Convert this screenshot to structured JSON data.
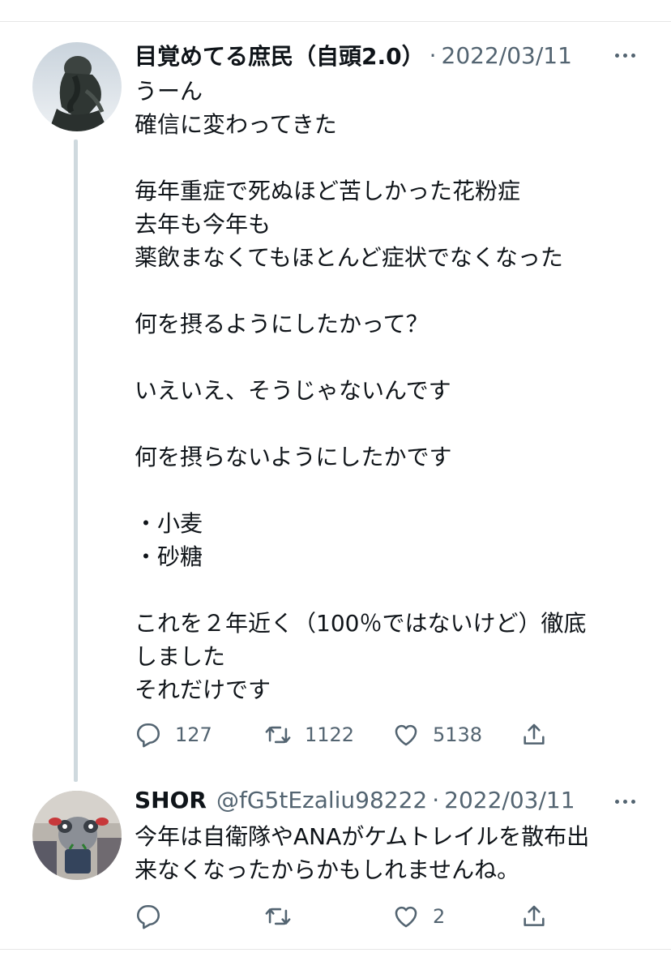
{
  "tweets": [
    {
      "name": "目覚めてる庶民（自頭2.0）",
      "handle": "",
      "date": "2022/03/11",
      "text": "うーん\n確信に変わってきた\n\n毎年重症で死ぬほど苦しかった花粉症\n去年も今年も\n薬飲まなくてもほとんど症状でなくなった\n\n何を摂るようにしたかって？\n\nいえいえ、そうじゃないんです\n\n何を摂らないようにしたかです\n\n・小麦\n・砂糖\n\nこれを２年近く（100％ではないけど）徹底\nしました\nそれだけです",
      "reply_count": "127",
      "retweet_count": "1122",
      "like_count": "5138",
      "avatar_icon": "thinker-statue-avatar"
    },
    {
      "name": "SHOR",
      "handle": "@fG5tEzaliu98222",
      "date": "2022/03/11",
      "text": "今年は自衛隊やANAがケムトレイルを散布出\n来なくなったからかもしれませんね。",
      "reply_count": "",
      "retweet_count": "",
      "like_count": "2",
      "avatar_icon": "plush-toy-avatar"
    }
  ],
  "separator": "·",
  "icons": {
    "reply": "reply-icon",
    "retweet": "retweet-icon",
    "like": "heart-icon",
    "share": "share-icon",
    "more": "more-icon"
  },
  "colors": {
    "text": "#0f1419",
    "secondary": "#536471",
    "thread_line": "#cfd9de"
  }
}
